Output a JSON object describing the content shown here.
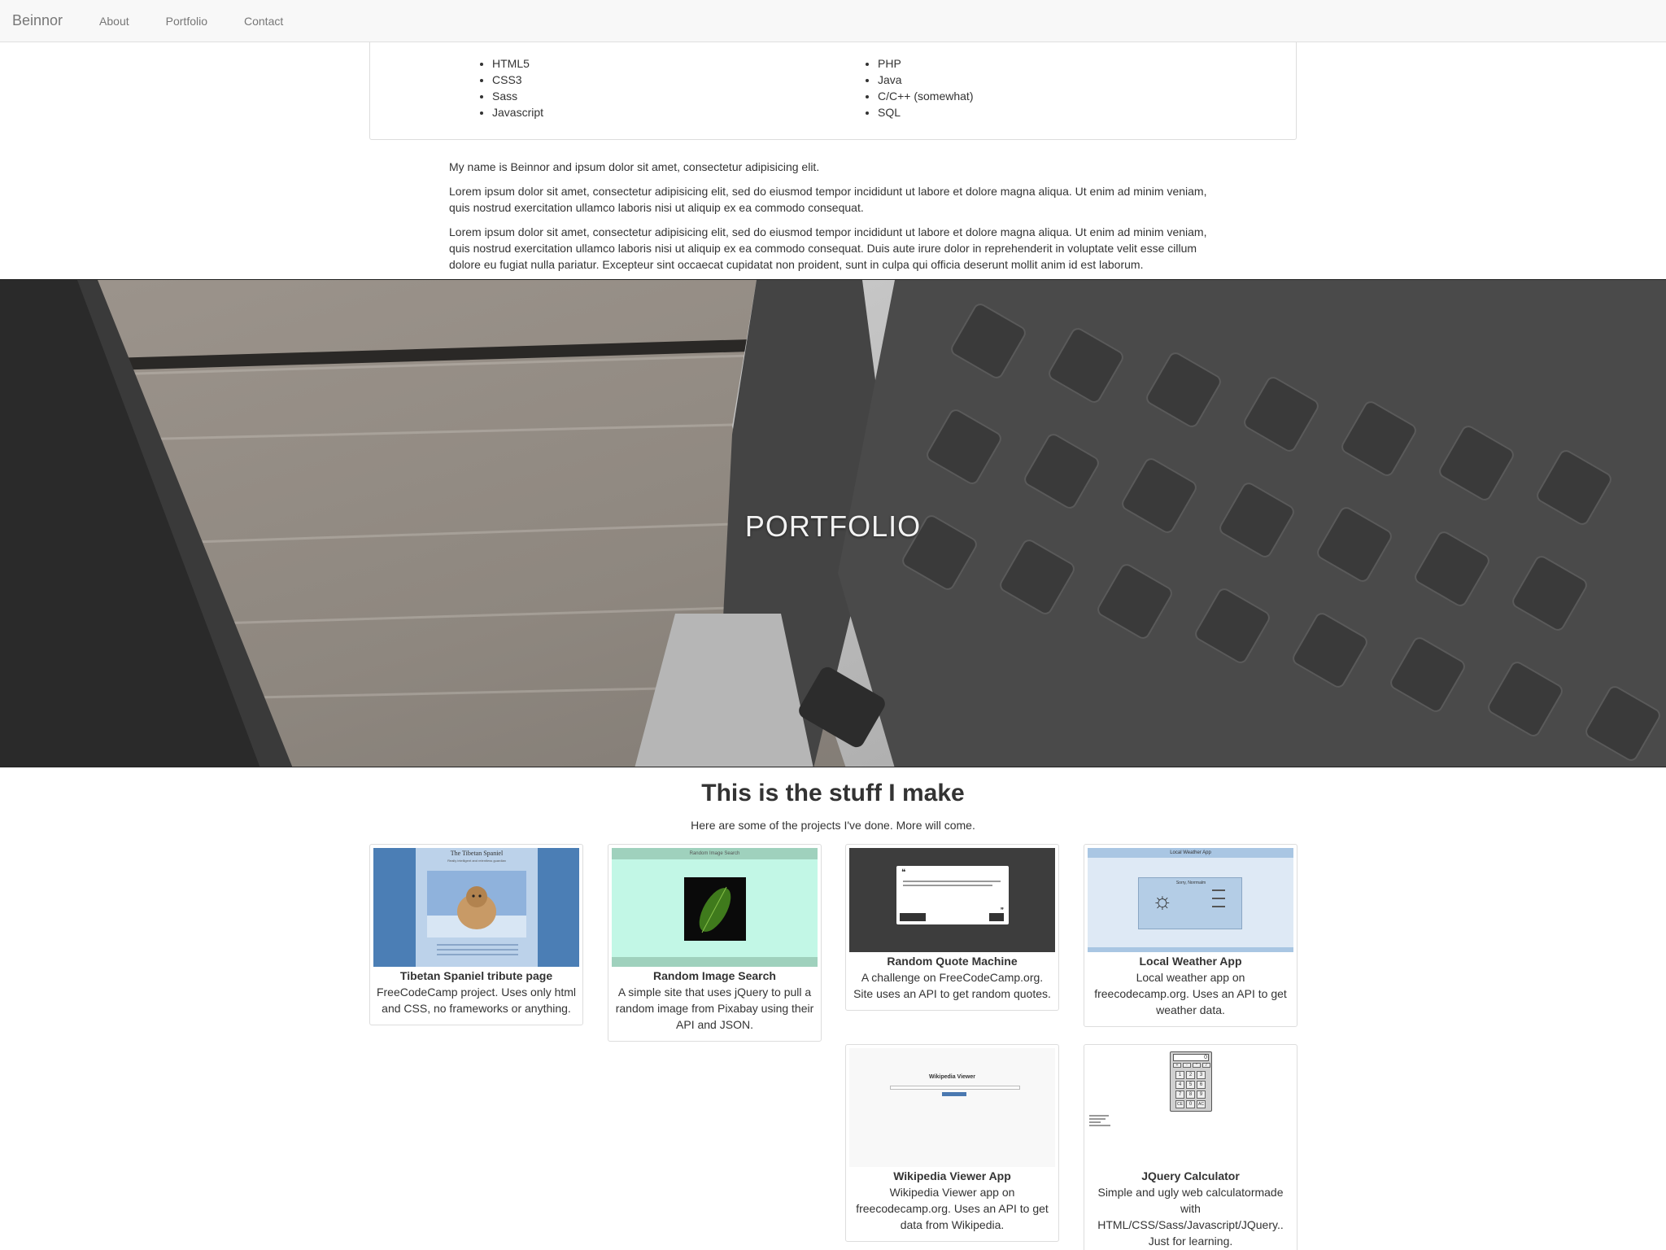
{
  "nav": {
    "brand": "Beinnor",
    "links": [
      "About",
      "Portfolio",
      "Contact"
    ]
  },
  "skills": {
    "left": [
      "HTML5",
      "CSS3",
      "Sass",
      "Javascript"
    ],
    "right": [
      "PHP",
      "Java",
      "C/C++ (somewhat)",
      "SQL"
    ]
  },
  "about": {
    "p1": "My name is Beinnor and ipsum dolor sit amet, consectetur adipisicing elit.",
    "p2": "Lorem ipsum dolor sit amet, consectetur adipisicing elit, sed do eiusmod tempor incididunt ut labore et dolore magna aliqua. Ut enim ad minim veniam, quis nostrud exercitation ullamco laboris nisi ut aliquip ex ea commodo consequat.",
    "p3": "Lorem ipsum dolor sit amet, consectetur adipisicing elit, sed do eiusmod tempor incididunt ut labore et dolore magna aliqua. Ut enim ad minim veniam, quis nostrud exercitation ullamco laboris nisi ut aliquip ex ea commodo consequat. Duis aute irure dolor in reprehenderit in voluptate velit esse cillum dolore eu fugiat nulla pariatur. Excepteur sint occaecat cupidatat non proident, sunt in culpa qui officia deserunt mollit anim id est laborum."
  },
  "hero": {
    "title": "PORTFOLIO"
  },
  "projects": {
    "heading": "This is the stuff I make",
    "subheading": "Here are some of the projects I've done. More will come.",
    "items": [
      {
        "title": "Tibetan Spaniel tribute page",
        "desc": "FreeCodeCamp project. Uses only html and CSS, no frameworks or anything.",
        "thumb_title": "The Tibetan Spaniel",
        "thumb_sub": "Really intelligent and relentless guardian"
      },
      {
        "title": "Random Image Search",
        "desc": "A simple site that uses jQuery to pull a random image from Pixabay using their API and JSON.",
        "thumb_title": "Random Image Search"
      },
      {
        "title": "Random Quote Machine",
        "desc": "A challenge on FreeCodeCamp.org. Site uses an API to get random quotes."
      },
      {
        "title": "Local Weather App",
        "desc": "Local weather app on freecodecamp.org. Uses an API to get weather data.",
        "thumb_title": "Local Weather App",
        "thumb_sub": "Sorry, Norrmalm"
      },
      {
        "title": "Wikipedia Viewer App",
        "desc": "Wikipedia Viewer app on freecodecamp.org. Uses an API to get data from Wikipedia.",
        "thumb_title": "Wikipedia Viewer"
      },
      {
        "title": "JQuery Calculator",
        "desc": "Simple and ugly web calculatormade with HTML/CSS/Sass/Javascript/JQuery.. Just for learning.",
        "thumb_display": "0",
        "thumb_keys": [
          "+",
          "-",
          "*",
          "/",
          "1",
          "2",
          "3",
          "4",
          "5",
          "6",
          "7",
          "8",
          "9",
          "CE",
          "0",
          "AC"
        ]
      }
    ]
  },
  "colors": {
    "navbar_bg": "#f8f8f8",
    "nav_text": "#777777",
    "text": "#333333",
    "border": "#dddddd"
  }
}
